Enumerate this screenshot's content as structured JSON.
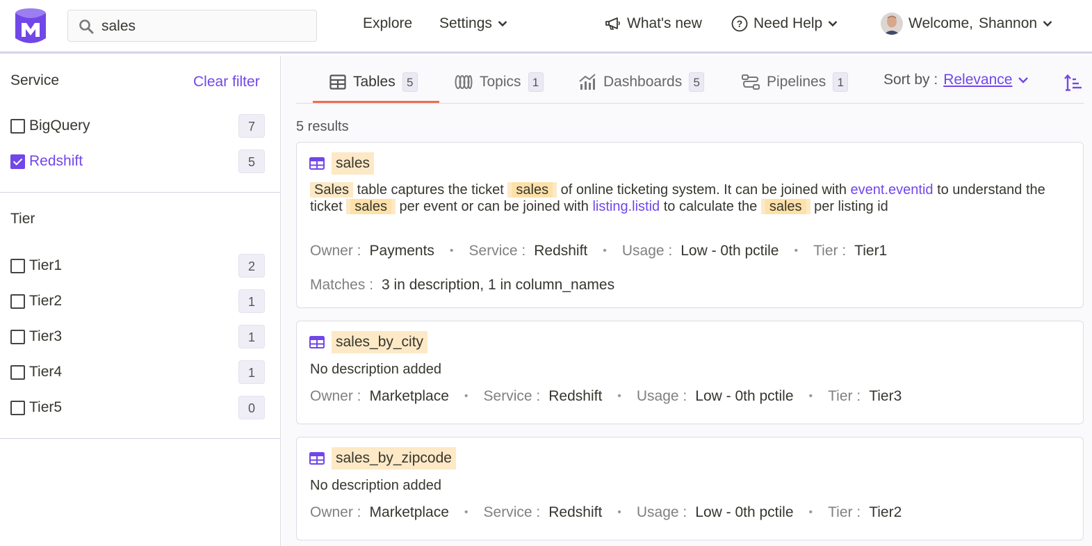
{
  "header": {
    "search_value": "sales",
    "explore_label": "Explore",
    "settings_label": "Settings",
    "whats_new_label": "What's new",
    "need_help_label": "Need Help",
    "welcome_label": "Welcome,",
    "user_name": "Shannon"
  },
  "sidebar": {
    "service_title": "Service",
    "clear_filter_label": "Clear filter",
    "services": [
      {
        "label": "BigQuery",
        "count": "7",
        "checked": false
      },
      {
        "label": "Redshift",
        "count": "5",
        "checked": true
      }
    ],
    "tier_title": "Tier",
    "tiers": [
      {
        "label": "Tier1",
        "count": "2"
      },
      {
        "label": "Tier2",
        "count": "1"
      },
      {
        "label": "Tier3",
        "count": "1"
      },
      {
        "label": "Tier4",
        "count": "1"
      },
      {
        "label": "Tier5",
        "count": "0"
      }
    ]
  },
  "tabs": [
    {
      "label": "Tables",
      "count": "5",
      "icon": "table-icon",
      "active": true
    },
    {
      "label": "Topics",
      "count": "1",
      "icon": "topics-icon"
    },
    {
      "label": "Dashboards",
      "count": "5",
      "icon": "chart-icon"
    },
    {
      "label": "Pipelines",
      "count": "1",
      "icon": "pipeline-icon"
    }
  ],
  "sort": {
    "label": "Sort by :",
    "value": "Relevance"
  },
  "results_count": "5 results",
  "results": [
    {
      "title": "sales",
      "desc": {
        "w1": "Sales",
        "t1": " table captures the ticket ",
        "w2": "sales",
        "t2": " of online ticketing system. It can be joined with ",
        "link1": "event.eventid",
        "t3": " to understand the ticket ",
        "w3": "sales",
        "t4": " per event or can be joined with ",
        "link2": "listing.listid",
        "t5": " to calculate the ",
        "w4": "sales",
        "t6": " per listing id"
      },
      "owner": "Payments",
      "service": "Redshift",
      "usage": "Low - 0th pctile",
      "tier": "Tier1",
      "matches": "3 in description,  1 in column_names"
    },
    {
      "title": "sales_by_city",
      "desc_text": "No description added",
      "owner": "Marketplace",
      "service": "Redshift",
      "usage": "Low - 0th pctile",
      "tier": "Tier3"
    },
    {
      "title": "sales_by_zipcode",
      "desc_text": "No description added",
      "owner": "Marketplace",
      "service": "Redshift",
      "usage": "Low - 0th pctile",
      "tier": "Tier2"
    }
  ],
  "meta_labels": {
    "owner": "Owner :",
    "service": "Service :",
    "usage": "Usage :",
    "tier": "Tier :",
    "matches": "Matches :",
    "dot": "•"
  },
  "colors": {
    "accent": "#7147e8",
    "tab_underline": "#ef6c4f",
    "highlight": "#fde9c6"
  }
}
